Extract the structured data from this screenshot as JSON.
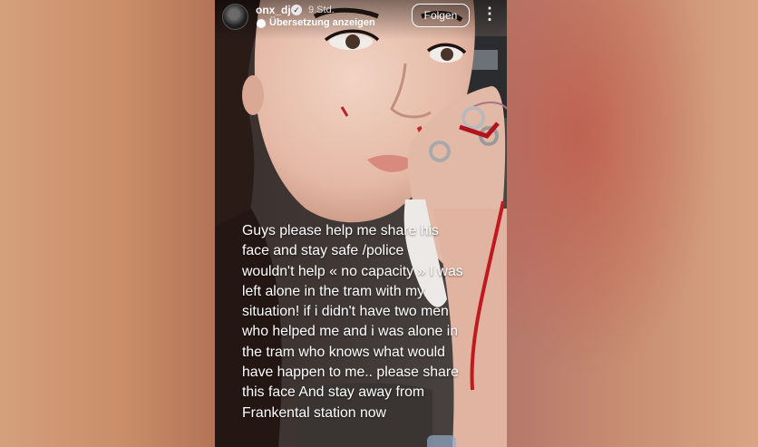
{
  "account": {
    "username": "onx_dj",
    "verified_icon": "verified-badge-icon",
    "time_ago": "9 Std.",
    "translate_label": "Übersetzung anzeigen",
    "follow_label": "Folgen",
    "more_icon": "⋮"
  },
  "story": {
    "caption": "Guys please help me share his\nface and stay safe /police\nwouldn't help « no capacity » I was\nleft alone in the tram with my\nsituation! if i didn't have two men\nwho helped me and i was alone in\nthe tram who knows what would\nhave happen to me.. please share\nthis face   And stay away from\nFrankental station now"
  },
  "colors": {
    "text": "#ffffff",
    "follow_border": "#ffffff"
  }
}
